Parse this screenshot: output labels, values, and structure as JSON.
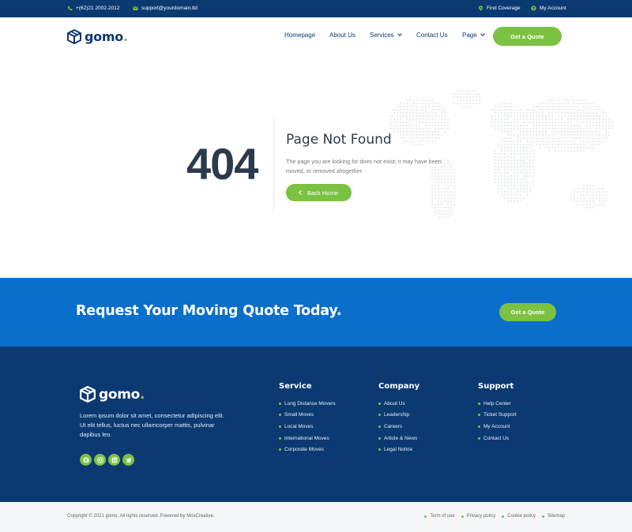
{
  "topbar": {
    "phone": "+(62)21 2002-2012",
    "email": "support@yourdomain.tld",
    "find_coverage": "Find Coverage",
    "my_account": "My Account"
  },
  "brand": {
    "name": "gomo",
    "dot": ".",
    "accent": "#7cc242",
    "navy": "#0b3a73",
    "blue": "#0a6fca"
  },
  "nav": {
    "items": [
      "Homepage",
      "About Us",
      "Services",
      "Contact Us",
      "Page"
    ],
    "cta": "Get a Quote"
  },
  "error": {
    "code": "404",
    "title": "Page Not Found",
    "text": "The page you are looking for does not exist; it may have been moved, or removed altogether.",
    "button": "Back Home"
  },
  "cta_band": {
    "title": "Request Your Moving Quote Today.",
    "button": "Get a Quote"
  },
  "footer": {
    "about": "Lorem ipsum dolor sit amet, consectetur adipiscing elit. Ut elit tellus, luctus nec ullamcorper mattis, pulvinar dapibus leo.",
    "socials": [
      "facebook-icon",
      "instagram-icon",
      "linkedin-icon",
      "twitter-icon"
    ],
    "columns": [
      {
        "title": "Service",
        "links": [
          "Long Distance Movers",
          "Small Moves",
          "Local Moves",
          "International Moves",
          "Corporate Moves"
        ]
      },
      {
        "title": "Company",
        "links": [
          "About Us",
          "Leadership",
          "Careers",
          "Article & News",
          "Legal Notice"
        ]
      },
      {
        "title": "Support",
        "links": [
          "Help Center",
          "Ticket Support",
          "My Account",
          "Contact Us"
        ]
      }
    ]
  },
  "bottom": {
    "copyright": "Copyright © 2021 gomo, All rights reserved. Powered by MoxCreative.",
    "links": [
      "Term of use",
      "Privacy policy",
      "Cookie policy",
      "Sitemap"
    ]
  }
}
